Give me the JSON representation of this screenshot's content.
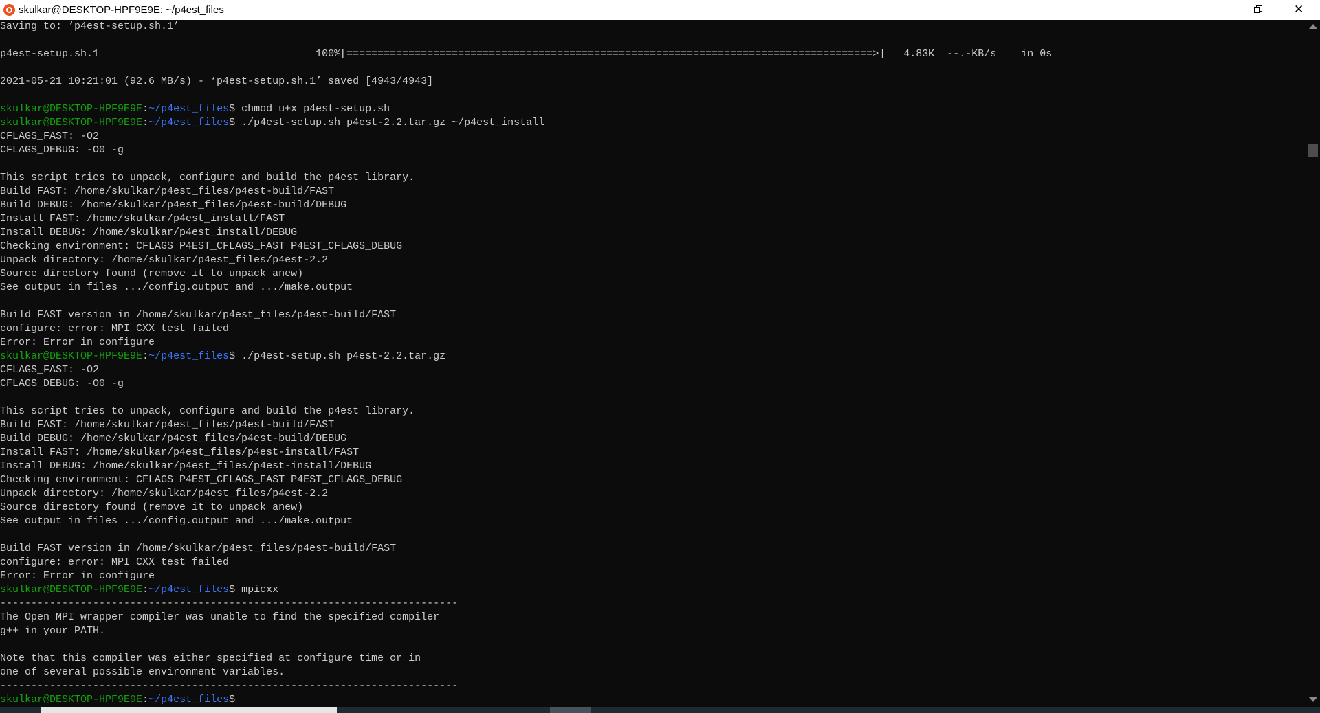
{
  "window": {
    "title": "skulkar@DESKTOP-HPF9E9E: ~/p4est_files",
    "icon": "ubuntu-icon",
    "colors": {
      "background": "#0c0c0c",
      "text": "#cccccc",
      "user_host": "#13a10e",
      "path": "#3b78ff"
    }
  },
  "terminal": {
    "lines": [
      {
        "type": "text",
        "text": "Saving to: ‘p4est-setup.sh.1’"
      },
      {
        "type": "text",
        "text": ""
      },
      {
        "type": "text",
        "text": "p4est-setup.sh.1                                   100%[=====================================================================================>]   4.83K  --.-KB/s    in 0s"
      },
      {
        "type": "text",
        "text": ""
      },
      {
        "type": "text",
        "text": "2021-05-21 10:21:01 (92.6 MB/s) - ‘p4est-setup.sh.1’ saved [4943/4943]"
      },
      {
        "type": "text",
        "text": ""
      },
      {
        "type": "prompt",
        "user": "skulkar@DESKTOP-HPF9E9E",
        "sep": ":",
        "path": "~/p4est_files",
        "sym": "$ ",
        "cmd": "chmod u+x p4est-setup.sh"
      },
      {
        "type": "prompt",
        "user": "skulkar@DESKTOP-HPF9E9E",
        "sep": ":",
        "path": "~/p4est_files",
        "sym": "$ ",
        "cmd": "./p4est-setup.sh p4est-2.2.tar.gz ~/p4est_install"
      },
      {
        "type": "text",
        "text": "CFLAGS_FAST: -O2"
      },
      {
        "type": "text",
        "text": "CFLAGS_DEBUG: -O0 -g"
      },
      {
        "type": "text",
        "text": ""
      },
      {
        "type": "text",
        "text": "This script tries to unpack, configure and build the p4est library."
      },
      {
        "type": "text",
        "text": "Build FAST: /home/skulkar/p4est_files/p4est-build/FAST"
      },
      {
        "type": "text",
        "text": "Build DEBUG: /home/skulkar/p4est_files/p4est-build/DEBUG"
      },
      {
        "type": "text",
        "text": "Install FAST: /home/skulkar/p4est_install/FAST"
      },
      {
        "type": "text",
        "text": "Install DEBUG: /home/skulkar/p4est_install/DEBUG"
      },
      {
        "type": "text",
        "text": "Checking environment: CFLAGS P4EST_CFLAGS_FAST P4EST_CFLAGS_DEBUG"
      },
      {
        "type": "text",
        "text": "Unpack directory: /home/skulkar/p4est_files/p4est-2.2"
      },
      {
        "type": "text",
        "text": "Source directory found (remove it to unpack anew)"
      },
      {
        "type": "text",
        "text": "See output in files .../config.output and .../make.output"
      },
      {
        "type": "text",
        "text": ""
      },
      {
        "type": "text",
        "text": "Build FAST version in /home/skulkar/p4est_files/p4est-build/FAST"
      },
      {
        "type": "text",
        "text": "configure: error: MPI CXX test failed"
      },
      {
        "type": "text",
        "text": "Error: Error in configure"
      },
      {
        "type": "prompt",
        "user": "skulkar@DESKTOP-HPF9E9E",
        "sep": ":",
        "path": "~/p4est_files",
        "sym": "$ ",
        "cmd": "./p4est-setup.sh p4est-2.2.tar.gz"
      },
      {
        "type": "text",
        "text": "CFLAGS_FAST: -O2"
      },
      {
        "type": "text",
        "text": "CFLAGS_DEBUG: -O0 -g"
      },
      {
        "type": "text",
        "text": ""
      },
      {
        "type": "text",
        "text": "This script tries to unpack, configure and build the p4est library."
      },
      {
        "type": "text",
        "text": "Build FAST: /home/skulkar/p4est_files/p4est-build/FAST"
      },
      {
        "type": "text",
        "text": "Build DEBUG: /home/skulkar/p4est_files/p4est-build/DEBUG"
      },
      {
        "type": "text",
        "text": "Install FAST: /home/skulkar/p4est_files/p4est-install/FAST"
      },
      {
        "type": "text",
        "text": "Install DEBUG: /home/skulkar/p4est_files/p4est-install/DEBUG"
      },
      {
        "type": "text",
        "text": "Checking environment: CFLAGS P4EST_CFLAGS_FAST P4EST_CFLAGS_DEBUG"
      },
      {
        "type": "text",
        "text": "Unpack directory: /home/skulkar/p4est_files/p4est-2.2"
      },
      {
        "type": "text",
        "text": "Source directory found (remove it to unpack anew)"
      },
      {
        "type": "text",
        "text": "See output in files .../config.output and .../make.output"
      },
      {
        "type": "text",
        "text": ""
      },
      {
        "type": "text",
        "text": "Build FAST version in /home/skulkar/p4est_files/p4est-build/FAST"
      },
      {
        "type": "text",
        "text": "configure: error: MPI CXX test failed"
      },
      {
        "type": "text",
        "text": "Error: Error in configure"
      },
      {
        "type": "prompt",
        "user": "skulkar@DESKTOP-HPF9E9E",
        "sep": ":",
        "path": "~/p4est_files",
        "sym": "$ ",
        "cmd": "mpicxx"
      },
      {
        "type": "text",
        "text": "--------------------------------------------------------------------------"
      },
      {
        "type": "text",
        "text": "The Open MPI wrapper compiler was unable to find the specified compiler"
      },
      {
        "type": "text",
        "text": "g++ in your PATH."
      },
      {
        "type": "text",
        "text": ""
      },
      {
        "type": "text",
        "text": "Note that this compiler was either specified at configure time or in"
      },
      {
        "type": "text",
        "text": "one of several possible environment variables."
      },
      {
        "type": "text",
        "text": "--------------------------------------------------------------------------"
      },
      {
        "type": "prompt",
        "user": "skulkar@DESKTOP-HPF9E9E",
        "sep": ":",
        "path": "~/p4est_files",
        "sym": "$ ",
        "cmd": ""
      }
    ]
  }
}
